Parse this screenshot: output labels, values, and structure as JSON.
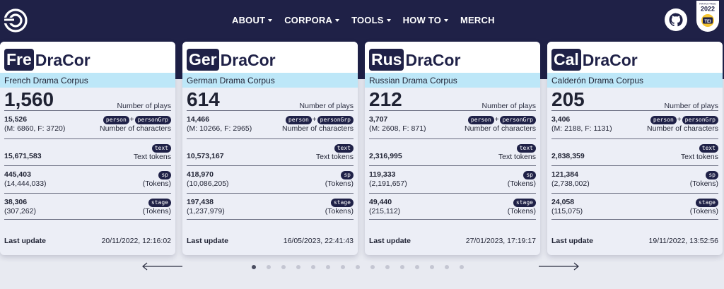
{
  "nav": {
    "items": [
      {
        "label": "ABOUT",
        "has_dropdown": true
      },
      {
        "label": "CORPORA",
        "has_dropdown": true
      },
      {
        "label": "TOOLS",
        "has_dropdown": true
      },
      {
        "label": "HOW TO",
        "has_dropdown": true
      },
      {
        "label": "MERCH",
        "has_dropdown": false
      }
    ],
    "badge": {
      "line1": "RAHTZ PRIZE",
      "year": "2022",
      "label": "TEI"
    }
  },
  "labels": {
    "number_of_plays": "Number of plays",
    "number_of_characters": "Number of characters",
    "text_tokens": "Text tokens",
    "tokens": "(Tokens)",
    "last_update": "Last update",
    "plus": "+",
    "brand": "DraCor"
  },
  "tags": {
    "person": "person",
    "personGrp": "personGrp",
    "text": "text",
    "sp": "sp",
    "stage": "stage"
  },
  "cards": [
    {
      "abbr": "Fre",
      "subtitle": "French Drama Corpus",
      "plays": "1,560",
      "characters": "15,526",
      "characters_split": "(M: 6860, F: 3720)",
      "text_tokens": "15,671,583",
      "sp": "445,403",
      "sp_tokens": "(14,444,033)",
      "stage": "38,306",
      "stage_tokens": "(307,262)",
      "last_update": "20/11/2022, 12:16:02"
    },
    {
      "abbr": "Ger",
      "subtitle": "German Drama Corpus",
      "plays": "614",
      "characters": "14,466",
      "characters_split": "(M: 10266, F: 2965)",
      "text_tokens": "10,573,167",
      "sp": "418,970",
      "sp_tokens": "(10,086,205)",
      "stage": "197,438",
      "stage_tokens": "(1,237,979)",
      "last_update": "16/05/2023, 22:41:43"
    },
    {
      "abbr": "Rus",
      "subtitle": "Russian Drama Corpus",
      "plays": "212",
      "characters": "3,707",
      "characters_split": "(M: 2608, F: 871)",
      "text_tokens": "2,316,995",
      "sp": "119,333",
      "sp_tokens": "(2,191,657)",
      "stage": "49,440",
      "stage_tokens": "(215,112)",
      "last_update": "27/01/2023, 17:19:17"
    },
    {
      "abbr": "Cal",
      "subtitle": "Calderón Drama Corpus",
      "plays": "205",
      "characters": "3,406",
      "characters_split": "(M: 2188, F: 1131)",
      "text_tokens": "2,838,359",
      "sp": "121,384",
      "sp_tokens": "(2,738,002)",
      "stage": "24,058",
      "stage_tokens": "(115,075)",
      "last_update": "19/11/2022, 13:52:56"
    }
  ],
  "carousel": {
    "page_count": 15,
    "active_page": 1
  },
  "colors": {
    "header": "#1f2147",
    "subtitle_bar": "#bde7f8",
    "page_bg": "#e8eaf1"
  }
}
